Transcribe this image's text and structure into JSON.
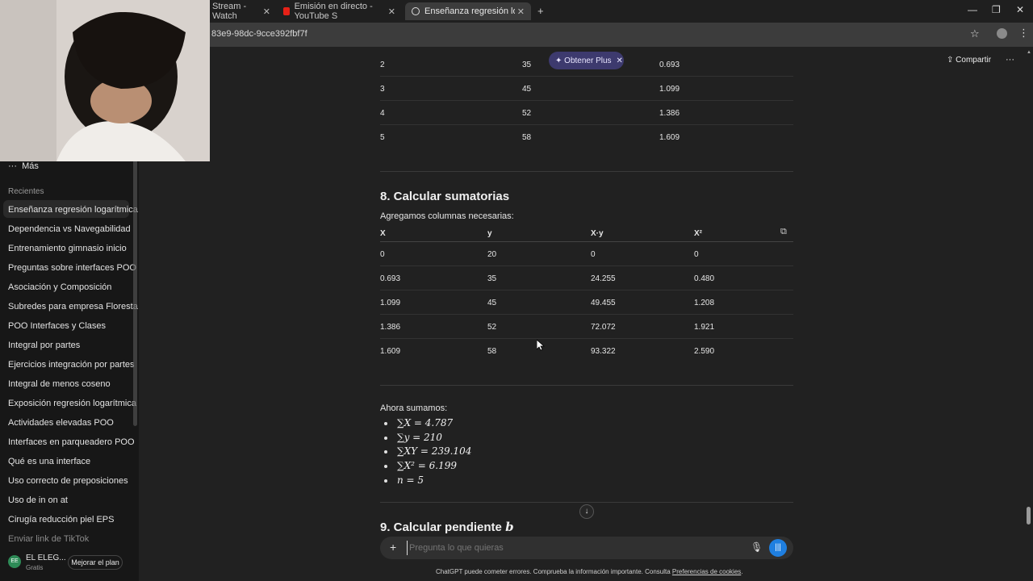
{
  "browser": {
    "tabs": [
      {
        "title": "Stream - Watch",
        "active": false
      },
      {
        "title": "Emisión en directo - YouTube S",
        "active": false
      },
      {
        "title": "Enseñanza regresión logarítmic",
        "active": true
      }
    ],
    "new_tab": "+",
    "url": "83e9-98dc-9cce392fbf7f",
    "window": {
      "minimize": "—",
      "maximize": "❐",
      "close": "✕"
    }
  },
  "sidebar": {
    "more": "Más",
    "recents_label": "Recientes",
    "items": [
      "Enseñanza regresión logarítmica",
      "Dependencia vs Navegabilidad",
      "Entrenamiento gimnasio inicio",
      "Preguntas sobre interfaces POO",
      "Asociación y Composición",
      "Subredes para empresa Floresta",
      "POO Interfaces y Clases",
      "Integral por partes",
      "Ejercicios integración por partes",
      "Integral de menos coseno",
      "Exposición regresión logarítmica",
      "Actividades elevadas POO",
      "Interfaces en parqueadero POO",
      "Qué es una interface",
      "Uso correcto de preposiciones",
      "Uso de in on at",
      "Cirugía reducción piel EPS",
      "Enviar link de TikTok"
    ],
    "user": {
      "initials": "EE",
      "name": "EL ELEG...",
      "plan": "Gratis"
    },
    "upgrade": "Mejorar el plan"
  },
  "header": {
    "plus_pill": "Obtener Plus",
    "share": "Compartir",
    "more": "···"
  },
  "top_table": {
    "rows": [
      [
        "2",
        "35",
        "0.693"
      ],
      [
        "3",
        "45",
        "1.099"
      ],
      [
        "4",
        "52",
        "1.386"
      ],
      [
        "5",
        "58",
        "1.609"
      ]
    ]
  },
  "section8": {
    "title": "8. Calcular sumatorias",
    "intro": "Agregamos columnas necesarias:",
    "headers": [
      "X",
      "y",
      "X·y",
      "X²"
    ],
    "rows": [
      [
        "0",
        "20",
        "0",
        "0"
      ],
      [
        "0.693",
        "35",
        "24.255",
        "0.480"
      ],
      [
        "1.099",
        "45",
        "49.455",
        "1.208"
      ],
      [
        "1.386",
        "52",
        "72.072",
        "1.921"
      ],
      [
        "1.609",
        "58",
        "93.322",
        "2.590"
      ]
    ],
    "sum_intro": "Ahora sumamos:",
    "sums": [
      "∑X = 4.787",
      "∑y = 210",
      "∑XY = 239.104",
      "∑X² = 6.199",
      "n = 5"
    ]
  },
  "section9": {
    "title": "9. Calcular pendiente",
    "var": "b"
  },
  "composer": {
    "placeholder": "Pregunta lo que quieras"
  },
  "footer": {
    "text": "ChatGPT puede cometer errores. Comprueba la información importante. Consulta ",
    "link": "Preferencias de cookies",
    "end": "."
  },
  "colors": {
    "accent_blue": "#1f7fe0",
    "plus_pill": "#3d3a6e",
    "youtube_red": "#e62117"
  }
}
